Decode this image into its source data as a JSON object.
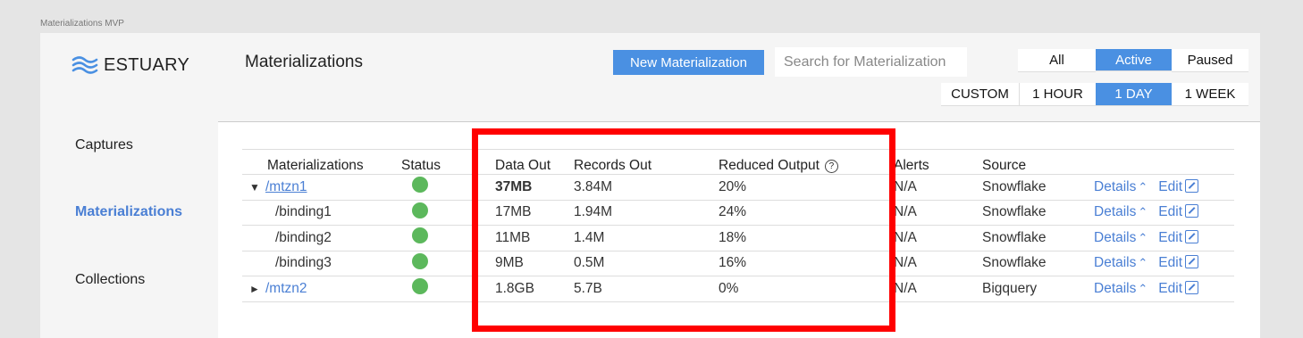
{
  "frame_label": "Materializations MVP",
  "brand": {
    "name": "ESTUARY",
    "accent": "#4a90e2"
  },
  "sidebar": {
    "items": [
      {
        "label": "Captures",
        "active": false
      },
      {
        "label": "Materializations",
        "active": true
      },
      {
        "label": "Collections",
        "active": false
      }
    ]
  },
  "header": {
    "title": "Materializations",
    "new_button": "New Materialization",
    "search_placeholder": "Search for Materialization",
    "status_filter": {
      "options": [
        "All",
        "Active",
        "Paused"
      ],
      "selected": "Active"
    },
    "time_filter": {
      "options": [
        "CUSTOM",
        "1 HOUR",
        "1 DAY",
        "1 WEEK"
      ],
      "selected": "1 DAY"
    }
  },
  "table": {
    "columns": [
      "Materializations",
      "Status",
      "Data Out",
      "Records Out",
      "Reduced Output",
      "Alerts",
      "Source",
      ""
    ],
    "rows": [
      {
        "caret": "▼",
        "name": "/mtzn1",
        "is_link": true,
        "status": "green",
        "data_out": "37MB",
        "records_out": "3.84M",
        "reduced": "20%",
        "alerts": "N/A",
        "source": "Snowflake",
        "details": "Details",
        "edit": "Edit"
      },
      {
        "caret": "",
        "name": "/binding1",
        "is_link": false,
        "status": "green",
        "data_out": "17MB",
        "records_out": "1.94M",
        "reduced": "24%",
        "alerts": "N/A",
        "source": "Snowflake",
        "details": "Details",
        "edit": "Edit"
      },
      {
        "caret": "",
        "name": "/binding2",
        "is_link": false,
        "status": "green",
        "data_out": "11MB",
        "records_out": "1.4M",
        "reduced": "18%",
        "alerts": "N/A",
        "source": "Snowflake",
        "details": "Details",
        "edit": "Edit"
      },
      {
        "caret": "",
        "name": "/binding3",
        "is_link": false,
        "status": "green",
        "data_out": "9MB",
        "records_out": "0.5M",
        "reduced": "16%",
        "alerts": "N/A",
        "source": "Snowflake",
        "details": "Details",
        "edit": "Edit"
      },
      {
        "caret": "►",
        "name": "/mtzn2",
        "is_link": true,
        "status": "green",
        "data_out": "1.8GB",
        "records_out": "5.7B",
        "reduced": "0%",
        "alerts": "N/A",
        "source": "Bigquery",
        "details": "Details",
        "edit": "Edit"
      }
    ]
  },
  "colors": {
    "status_green": "#5cb85c",
    "highlight": "#ff0000",
    "link": "#4a7fd4"
  }
}
